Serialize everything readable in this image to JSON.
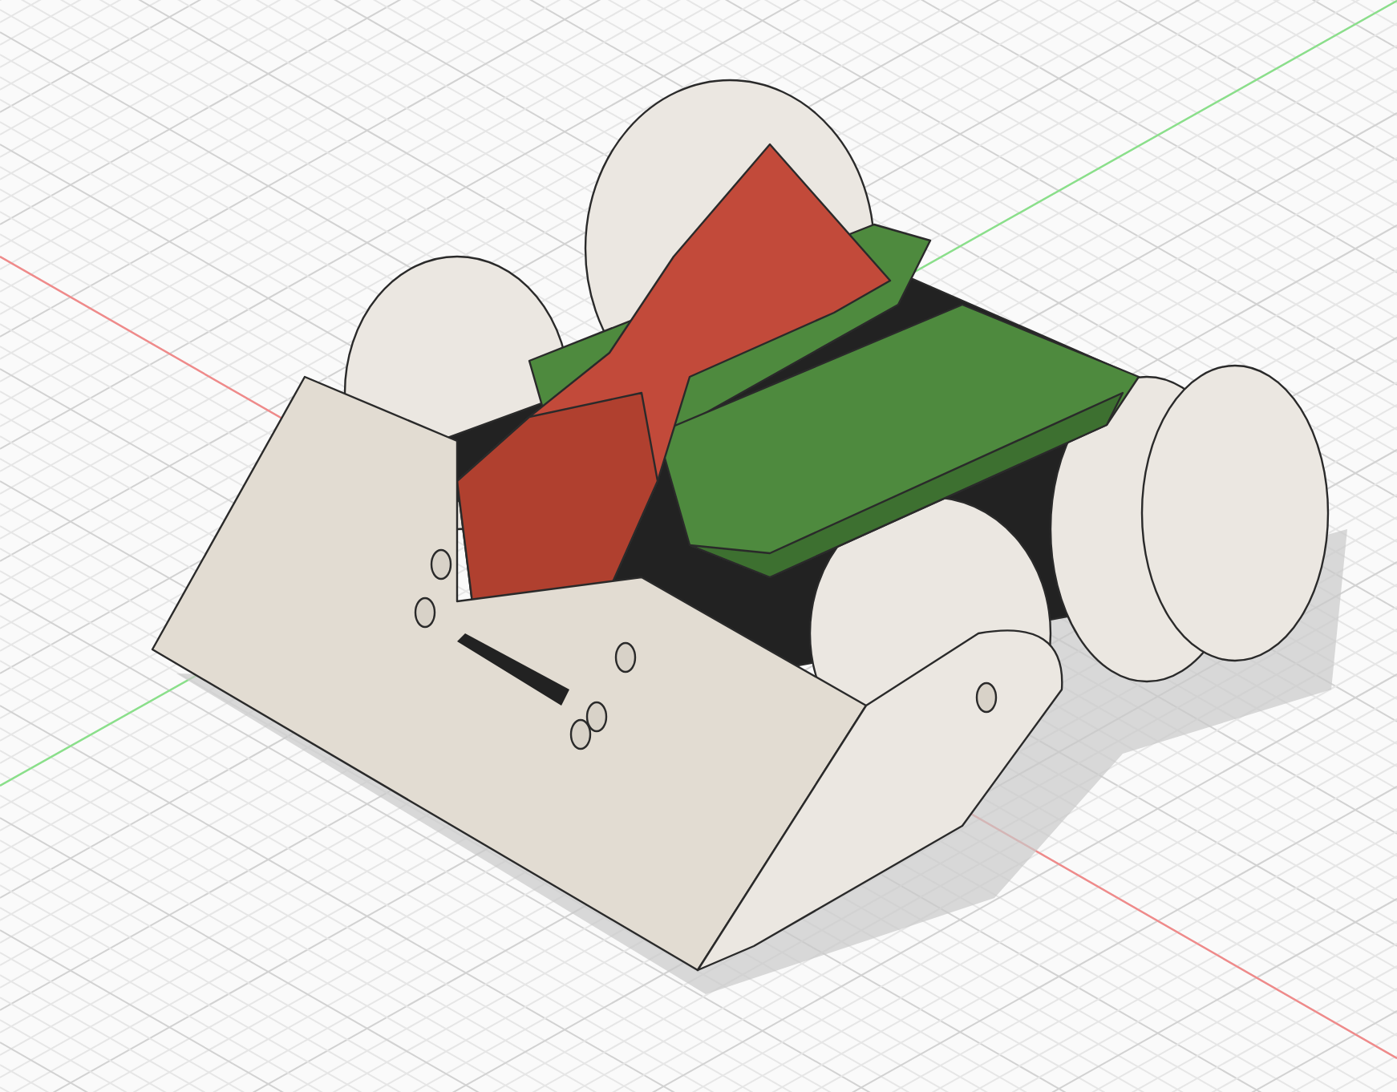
{
  "viewport": {
    "axes": [
      {
        "kind": "x",
        "color": "#f08a8a"
      },
      {
        "kind": "y",
        "color": "#8ae08a"
      }
    ]
  }
}
